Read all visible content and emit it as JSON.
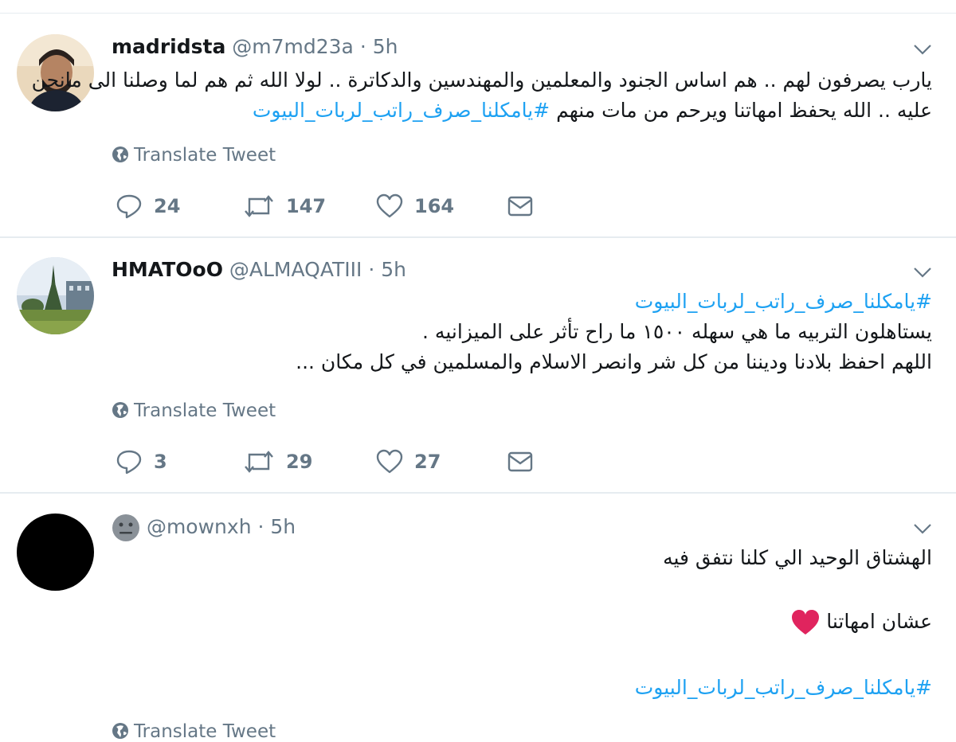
{
  "tweets": [
    {
      "name": "madridsta",
      "handle": "@m7md23a",
      "separator": "·",
      "time": "5h",
      "lines": [
        "يارب يصرفون لهم .. هم اساس الجنود والمعلمين والمهندسين والدكاترة .. لولا الله ثم هم لما وصلنا الى مانحن",
        "عليه .. الله يحفظ امهاتنا ويرحم من مات منهم"
      ],
      "hashtag": "#يامكلنا_صرف_راتب_لربات_البيوت",
      "translate": "Translate Tweet",
      "replies": "24",
      "retweets": "147",
      "likes": "164"
    },
    {
      "name": "HMATOoO",
      "handle": "@ALMAQATIII",
      "separator": "·",
      "time": "5h",
      "hashtag": "#يامكلنا_صرف_راتب_لربات_البيوت",
      "lines": [
        "يستاهلون التربيه ما هي سهله ١٥٠٠ ما راح تأثر على الميزانيه .",
        "اللهم احفظ بلادنا وديننا من كل شر وانصر الاسلام والمسلمين في كل مكان ..."
      ],
      "translate": "Translate Tweet",
      "replies": "3",
      "retweets": "29",
      "likes": "27"
    },
    {
      "handle": "@mownxh",
      "separator": "·",
      "time": "5h",
      "line1": "الهشتاق الوحيد الي كلنا نتفق فيه",
      "line2": "عشان امهاتنا",
      "hashtag": "#يامكلنا_صرف_راتب_لربات_البيوت",
      "translate": "Translate Tweet"
    }
  ],
  "colors": {
    "accent": "#1da1f2",
    "muted": "#657786",
    "heart": "#e0245e"
  },
  "icons": [
    "chevron-down-icon",
    "globe-icon",
    "reply-icon",
    "retweet-icon",
    "like-icon",
    "direct-message-icon",
    "heart-emoji-icon"
  ]
}
